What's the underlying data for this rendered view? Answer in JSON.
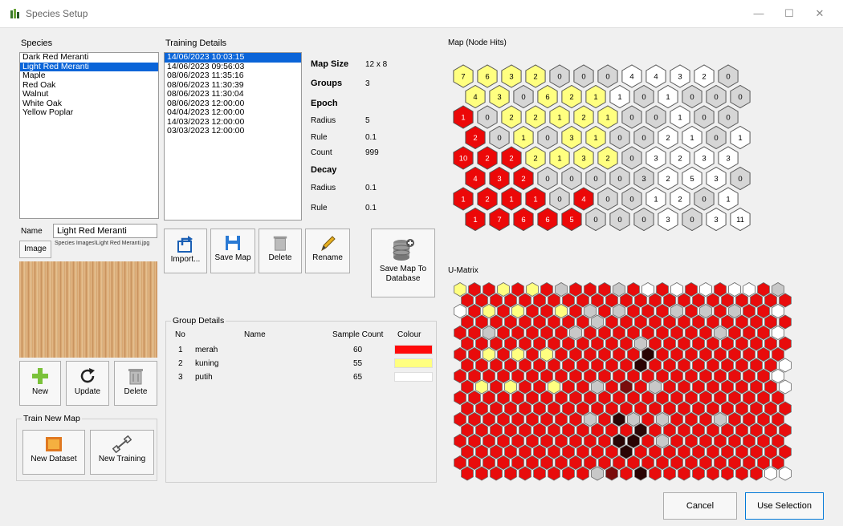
{
  "window": {
    "title": "Species Setup",
    "minimize": "—",
    "maximize": "☐",
    "close": "✕"
  },
  "species": {
    "label": "Species",
    "items": [
      "Dark Red Meranti",
      "Light Red Meranti",
      "Maple",
      "Red Oak",
      "Walnut",
      "White Oak",
      "Yellow Poplar"
    ],
    "selected_index": 1,
    "name_label": "Name",
    "name_value": "Light Red Meranti",
    "image_label": "Image",
    "image_path": "Species Images\\Light Red Meranti.jpg",
    "new_label": "New",
    "update_label": "Update",
    "delete_label": "Delete"
  },
  "train_new_map": {
    "title": "Train New Map",
    "new_dataset": "New Dataset",
    "new_training": "New Training"
  },
  "training": {
    "label": "Training Details",
    "items": [
      "14/06/2023 10:03:15",
      "14/06/2023 09:56:03",
      "08/06/2023 11:35:16",
      "08/06/2023 11:30:39",
      "08/06/2023 11:30:04",
      "08/06/2023 12:00:00",
      "04/04/2023 12:00:00",
      "14/03/2023 12:00:00",
      "03/03/2023 12:00:00"
    ],
    "selected_index": 0,
    "map_size_label": "Map Size",
    "map_size": "12 x 8",
    "groups_label": "Groups",
    "groups": "3",
    "epoch_label": "Epoch",
    "epoch_radius_label": "Radius",
    "epoch_radius": "5",
    "epoch_rule_label": "Rule",
    "epoch_rule": "0.1",
    "epoch_count_label": "Count",
    "epoch_count": "999",
    "decay_label": "Decay",
    "decay_radius_label": "Radius",
    "decay_radius": "0.1",
    "decay_rule_label": "Rule",
    "decay_rule": "0.1",
    "import_label": "Import...",
    "save_map_label": "Save Map",
    "delete_label": "Delete",
    "rename_label": "Rename",
    "save_db_label_1": "Save Map To",
    "save_db_label_2": "Database"
  },
  "group_details": {
    "title": "Group Details",
    "columns": {
      "no": "No",
      "name": "Name",
      "count": "Sample Count",
      "colour": "Colour"
    },
    "rows": [
      {
        "no": "1",
        "name": "merah",
        "count": "60",
        "color": "#ff0a0a"
      },
      {
        "no": "2",
        "name": "kuning",
        "count": "55",
        "color": "#ffff80"
      },
      {
        "no": "3",
        "name": "putih",
        "count": "65",
        "color": "#ffffff"
      }
    ]
  },
  "node_hits": {
    "title": "Map (Node Hits)",
    "colors": {
      "R": "#ec0808",
      "Y": "#ffff80",
      "G": "#d6d6d6",
      "W": "#ffffff"
    },
    "rows": [
      {
        "c": "YYYYGGGWWWWG",
        "v": [
          "7",
          "6",
          "3",
          "2",
          "0",
          "0",
          "0",
          "4",
          "4",
          "3",
          "2",
          "0"
        ]
      },
      {
        "c": "YYGYYYWGWGGG",
        "v": [
          "4",
          "3",
          "0",
          "6",
          "2",
          "1",
          "1",
          "0",
          "1",
          "0",
          "0",
          "0"
        ]
      },
      {
        "c": "RGYYYYYGGWGG",
        "v": [
          "1",
          "0",
          "2",
          "2",
          "1",
          "2",
          "1",
          "0",
          "0",
          "1",
          "0",
          "0"
        ]
      },
      {
        "c": "RGYGYYGGWWGW",
        "v": [
          "2",
          "0",
          "1",
          "0",
          "3",
          "1",
          "0",
          "0",
          "2",
          "1",
          "0",
          "1"
        ]
      },
      {
        "c": "RRRYYYYGWWWW",
        "v": [
          "10",
          "2",
          "2",
          "2",
          "1",
          "3",
          "2",
          "0",
          "3",
          "2",
          "3",
          "3"
        ]
      },
      {
        "c": "RRRGGGGGWWWG",
        "v": [
          "4",
          "3",
          "2",
          "0",
          "0",
          "0",
          "0",
          "3",
          "2",
          "5",
          "3",
          "0"
        ]
      },
      {
        "c": "RRRRGRGGWWGW",
        "v": [
          "1",
          "2",
          "1",
          "1",
          "0",
          "4",
          "0",
          "0",
          "1",
          "2",
          "0",
          "1"
        ]
      },
      {
        "c": "RRRRRGGGWGWW",
        "v": [
          "1",
          "7",
          "6",
          "6",
          "5",
          "0",
          "0",
          "0",
          "3",
          "0",
          "3",
          "11"
        ]
      }
    ]
  },
  "umatrix": {
    "title": "U-Matrix",
    "cols": 23,
    "colors": {
      "R": "#e80c0c",
      "D": "#2a0404",
      "M": "#7a0c0c",
      "Y": "#ffff80",
      "G": "#c8c8c8",
      "W": "#ffffff"
    },
    "rows": [
      "YRRYRYRGRRRGRWRWRWRWWRG",
      "RRRRRRRRRRRRRRRRRRRRRRR",
      "WRYRYRRYRGRGRRRGRGRGRRW",
      "RRRRRRRRRGRRRRRRRRRRRRR",
      "RRGRRRRRGRRRRRRRRRGRRRW",
      "RRRRRRRRRRRRGRRRRRRRRRR",
      "RRYRYRYRRRRRRDRRRRRRRRR",
      "RRRRRRRRRRRRDRRRRRRRRRW",
      "RRRRRRRRRRRRRRRRRRRRRRW",
      "RYRYRRYRRGRMRGRRRRRRRRW",
      "RRRRRRRRRRRRRRRRRRRRRRR",
      "RRRRRRRRRRRRRRRRRRRRRRR",
      "RRRRRRRRRGRDGRGRRRGRRRR",
      "RRRRRRRRRRRRDRRRRRRRRRR",
      "RRRRRRRRRRRDDRGRRRRRRRR",
      "RRRRRRRRRRRDRRRRRRRRRRR",
      "RRRRRRRRRRRRRRRRRRRRRRR",
      "RRRRRRRRRGMRDRRRRRRRRWW"
    ]
  },
  "footer": {
    "cancel": "Cancel",
    "use_selection": "Use Selection"
  }
}
